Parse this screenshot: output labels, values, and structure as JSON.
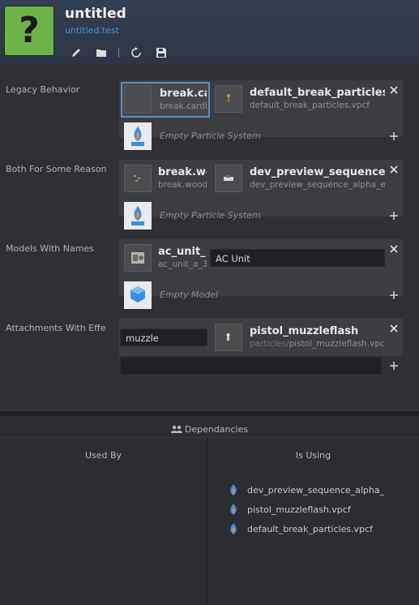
{
  "header": {
    "icon_glyph": "?",
    "title": "untitled",
    "subtitle": "untitled.test",
    "toolbar": [
      "pencil-icon",
      "folder-icon",
      "refresh-icon",
      "save-icon"
    ]
  },
  "rows": [
    {
      "label": "Legacy Behavior",
      "items": [
        {
          "name": "break.ca",
          "file": "break.cardbo"
        },
        {
          "name": "default_break_particles",
          "file": "default_break_particles.vpcf"
        }
      ],
      "empty_label": "Empty Particle System"
    },
    {
      "label": "Both For Some Reason",
      "items": [
        {
          "name": "break.wo",
          "file": "break.wood."
        },
        {
          "name": "dev_preview_sequence_",
          "file": "dev_preview_sequence_alpha_effe"
        }
      ],
      "empty_label": "Empty Particle System"
    },
    {
      "label": "Models With Names",
      "item": {
        "name": "ac_unit_",
        "file": "ac_unit_a_3"
      },
      "name_value": "AC Unit",
      "empty_label": "Empty Model"
    },
    {
      "label": "Attachments With Effects",
      "attachment_value": "muzzle",
      "item": {
        "name": "pistol_muzzleflash",
        "file_prefix": "particles/",
        "file": "pistol_muzzleflash.vpcf"
      }
    }
  ],
  "dependencies": {
    "title": "Dependancies",
    "used_by": "Used By",
    "is_using": "Is Using",
    "using_items": [
      "dev_preview_sequence_alpha_",
      "pistol_muzzleflash.vpcf",
      "default_break_particles.vpcf"
    ]
  },
  "colors": {
    "accent": "#4a8fe0",
    "icon_green": "#6db34a"
  }
}
